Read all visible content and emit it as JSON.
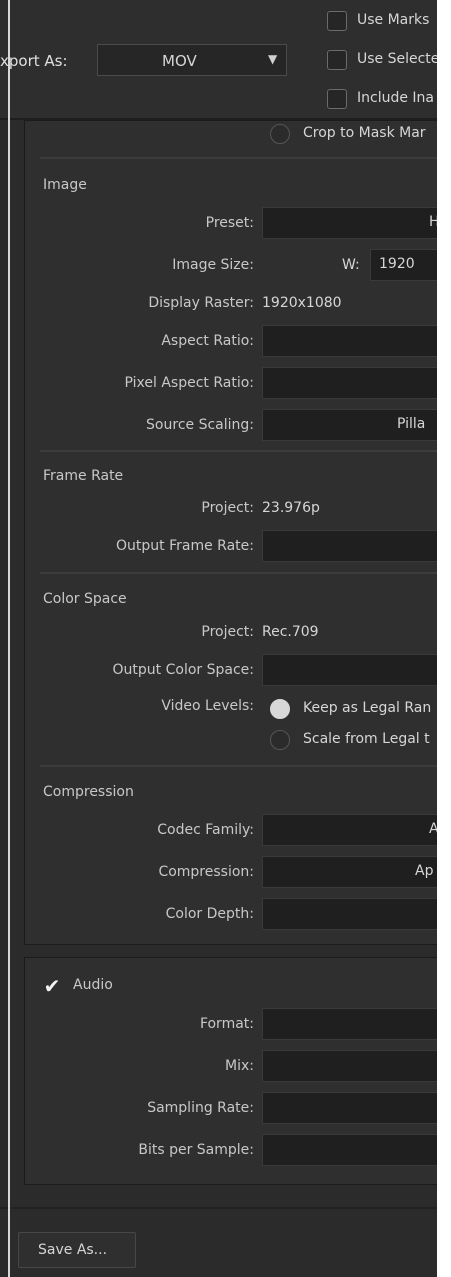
{
  "top": {
    "export_label": "xport As:",
    "export_value": "MOV",
    "use_marks": "Use Marks",
    "use_selected": "Use Selecte",
    "include": "Include Ina",
    "crop": "Crop to Mask Mar"
  },
  "image": {
    "heading": "Image",
    "preset_label": "Preset:",
    "preset_value": "H",
    "image_size_label": "Image Size:",
    "w_label": "W:",
    "w_value": "1920",
    "display_raster_label": "Display Raster:",
    "display_raster_value": "1920x1080",
    "aspect_ratio_label": "Aspect Ratio:",
    "pixel_aspect_label": "Pixel Aspect Ratio:",
    "source_scaling_label": "Source Scaling:",
    "source_scaling_value": "Pilla"
  },
  "frame_rate": {
    "heading": "Frame Rate",
    "project_label": "Project:",
    "project_value": "23.976p",
    "output_label": "Output Frame Rate:"
  },
  "color_space": {
    "heading": "Color Space",
    "project_label": "Project:",
    "project_value": "Rec.709",
    "output_label": "Output Color Space:",
    "video_levels_label": "Video Levels:",
    "keep_legal": "Keep as Legal Ran",
    "scale_legal": "Scale from Legal t"
  },
  "compression": {
    "heading": "Compression",
    "codec_label": "Codec Family:",
    "codec_value": "A",
    "compression_label": "Compression:",
    "compression_value": "Ap",
    "color_depth_label": "Color Depth:"
  },
  "audio": {
    "heading": "Audio",
    "enabled": true,
    "format_label": "Format:",
    "mix_label": "Mix:",
    "sampling_label": "Sampling Rate:",
    "bits_label": "Bits per Sample:"
  },
  "footer": {
    "save_as": "Save As..."
  },
  "colors": {
    "background": "#2b2b2b",
    "field": "#1f1f1f",
    "text": "#d6d6d6"
  }
}
